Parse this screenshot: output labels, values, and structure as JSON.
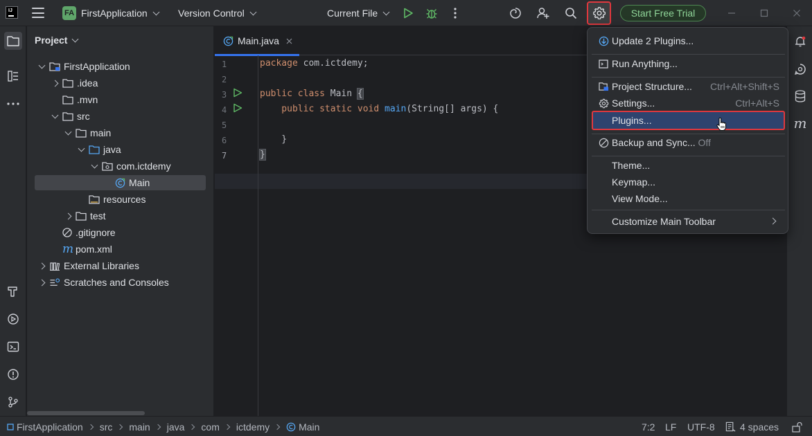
{
  "titlebar": {
    "logo_text": "IJ",
    "project_badge": "FA",
    "project_name": "FirstApplication",
    "vcs_label": "Version Control",
    "run_config": "Current File",
    "trial_button": "Start Free Trial"
  },
  "project_panel": {
    "title": "Project",
    "tree": [
      {
        "label": "FirstApplication",
        "depth": 0,
        "kind": "module",
        "expanded": true
      },
      {
        "label": ".idea",
        "depth": 1,
        "kind": "folder",
        "expanded": false
      },
      {
        "label": ".mvn",
        "depth": 1,
        "kind": "folder",
        "leaf": true
      },
      {
        "label": "src",
        "depth": 1,
        "kind": "folder",
        "expanded": true
      },
      {
        "label": "main",
        "depth": 2,
        "kind": "folder",
        "expanded": true
      },
      {
        "label": "java",
        "depth": 3,
        "kind": "source-folder",
        "expanded": true
      },
      {
        "label": "com.ictdemy",
        "depth": 4,
        "kind": "package",
        "expanded": true
      },
      {
        "label": "Main",
        "depth": 5,
        "kind": "class",
        "selected": true
      },
      {
        "label": "resources",
        "depth": 3,
        "kind": "resources-folder"
      },
      {
        "label": "test",
        "depth": 2,
        "kind": "folder",
        "expanded": false
      },
      {
        "label": ".gitignore",
        "depth": 1,
        "kind": "ignore-file"
      },
      {
        "label": "pom.xml",
        "depth": 1,
        "kind": "maven-file"
      },
      {
        "label": "External Libraries",
        "depth": 0,
        "kind": "libraries",
        "expanded": false
      },
      {
        "label": "Scratches and Consoles",
        "depth": 0,
        "kind": "scratches",
        "expanded": false
      }
    ]
  },
  "editor": {
    "tab_label": "Main.java",
    "line_numbers": [
      "1",
      "2",
      "3",
      "4",
      "5",
      "6",
      "7"
    ],
    "current_line": "7",
    "lines": {
      "l1_kw": "package",
      "l1_rest": " com.ictdemy;",
      "l3_kw": "public class",
      "l3_rest": " Main ",
      "l3_brace": "{",
      "l4_kw": "    public static void",
      "l4_fn": " main",
      "l4_rest": "(String[] args) {",
      "l6": "    }",
      "l7": "}"
    }
  },
  "settings_menu": {
    "items": [
      {
        "label": "Update 2 Plugins...",
        "icon": "update-icon"
      },
      {
        "label": "Run Anything...",
        "icon": "run-anything-icon"
      },
      {
        "label": "Project Structure...",
        "shortcut": "Ctrl+Alt+Shift+S",
        "icon": "project-structure-icon"
      },
      {
        "label": "Settings...",
        "shortcut": "Ctrl+Alt+S",
        "icon": "gear-icon"
      },
      {
        "label": "Plugins...",
        "highlighted": true
      },
      {
        "label": "Backup and Sync...",
        "suffix": "Off",
        "icon": "backup-sync-icon"
      },
      {
        "label": "Theme..."
      },
      {
        "label": "Keymap..."
      },
      {
        "label": "View Mode..."
      },
      {
        "label": "Customize Main Toolbar",
        "submenu": true
      }
    ]
  },
  "rightstrip": {
    "maven_glyph": "m"
  },
  "statusbar": {
    "breadcrumbs": [
      "FirstApplication",
      "src",
      "main",
      "java",
      "com",
      "ictdemy",
      "Main"
    ],
    "position": "7:2",
    "line_separator": "LF",
    "encoding": "UTF-8",
    "indent": "4 spaces"
  },
  "colors": {
    "accent": "#3574f0",
    "highlight_border": "#e0383e",
    "keyword": "#cf8e6d",
    "function": "#56a8f5",
    "trial_green": "#5fa66a"
  }
}
